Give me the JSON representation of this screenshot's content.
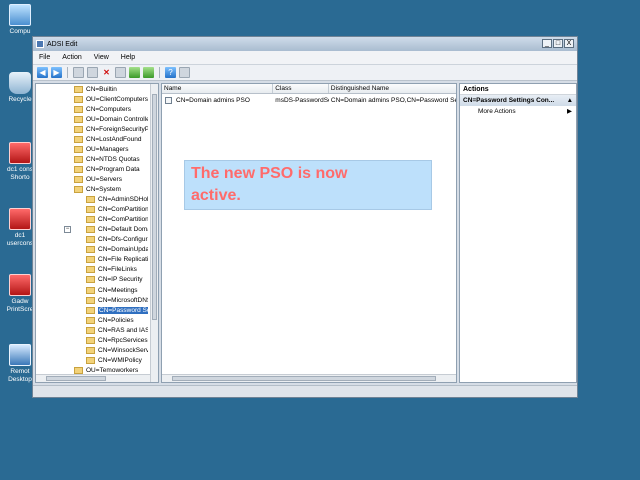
{
  "desktop": {
    "icons": [
      {
        "label": "Compu",
        "icon": "computer-icon"
      },
      {
        "label": "Recycle",
        "icon": "recycle-bin-icon"
      },
      {
        "label": "dc1 cons Shorto",
        "icon": "tool-icon"
      },
      {
        "label": "dc1 usercons",
        "icon": "tool-icon"
      },
      {
        "label": "Gadw PrintScre",
        "icon": "tool-icon"
      },
      {
        "label": "Remot Desktop",
        "icon": "remote-desktop-icon"
      }
    ]
  },
  "window": {
    "title": "ADSI Edit",
    "buttons": {
      "minimize": "_",
      "maximize": "□",
      "close": "X"
    }
  },
  "menu": [
    "File",
    "Action",
    "View",
    "Help"
  ],
  "toolbar_icons": [
    "back-icon",
    "forward-icon",
    "up-folder-icon",
    "properties-icon",
    "delete-icon",
    "export-icon",
    "refresh-icon",
    "export-list-icon",
    "help-icon",
    "show-pane-icon"
  ],
  "tree": {
    "items": [
      {
        "label": "CN=Builtin",
        "indent": 0
      },
      {
        "label": "OU=ClientComputers",
        "indent": 0
      },
      {
        "label": "CN=Computers",
        "indent": 0
      },
      {
        "label": "OU=Domain Controllers",
        "indent": 0
      },
      {
        "label": "CN=ForeignSecurityPrincipals",
        "indent": 0
      },
      {
        "label": "CN=LostAndFound",
        "indent": 0
      },
      {
        "label": "OU=Managers",
        "indent": 0
      },
      {
        "label": "CN=NTDS Quotas",
        "indent": 0
      },
      {
        "label": "CN=Program Data",
        "indent": 0
      },
      {
        "label": "OU=Servers",
        "indent": 0
      },
      {
        "label": "CN=System",
        "indent": 0
      },
      {
        "label": "CN=AdminSDHolder",
        "indent": 1
      },
      {
        "label": "CN=ComPartitions",
        "indent": 1
      },
      {
        "label": "CN=ComPartitionSets",
        "indent": 1
      },
      {
        "label": "CN=Default Domain Policy",
        "indent": 1
      },
      {
        "label": "CN=Dfs-Configuration",
        "indent": 1
      },
      {
        "label": "CN=DomainUpdates",
        "indent": 1
      },
      {
        "label": "CN=File Replication Service",
        "indent": 1
      },
      {
        "label": "CN=FileLinks",
        "indent": 1
      },
      {
        "label": "CN=IP Security",
        "indent": 1
      },
      {
        "label": "CN=Meetings",
        "indent": 1
      },
      {
        "label": "CN=MicrosoftDNS",
        "indent": 1
      },
      {
        "label": "CN=Password Settings Container",
        "indent": 1,
        "selected": true
      },
      {
        "label": "CN=Policies",
        "indent": 1
      },
      {
        "label": "CN=RAS and IAS Servers Access Check",
        "indent": 1
      },
      {
        "label": "CN=RpcServices",
        "indent": 1
      },
      {
        "label": "CN=WinsockServices",
        "indent": 1
      },
      {
        "label": "CN=WMIPolicy",
        "indent": 1
      },
      {
        "label": "OU=Temoworkers",
        "indent": 0
      }
    ],
    "expander": "−"
  },
  "list": {
    "columns": [
      "Name",
      "Class",
      "Distinguished Name"
    ],
    "rows": [
      {
        "name": "CN=Domain admins PSO",
        "class": "msDS-PasswordSettings",
        "dn": "CN=Domain admins PSO,CN=Password Settings Container"
      }
    ]
  },
  "actions": {
    "title": "Actions",
    "section": "CN=Password Settings Con...",
    "section_arrow": "▲",
    "items": [
      {
        "label": "More Actions",
        "arrow": "▶"
      }
    ]
  },
  "callout": {
    "line1": "The new PSO is now",
    "line2": "active."
  }
}
